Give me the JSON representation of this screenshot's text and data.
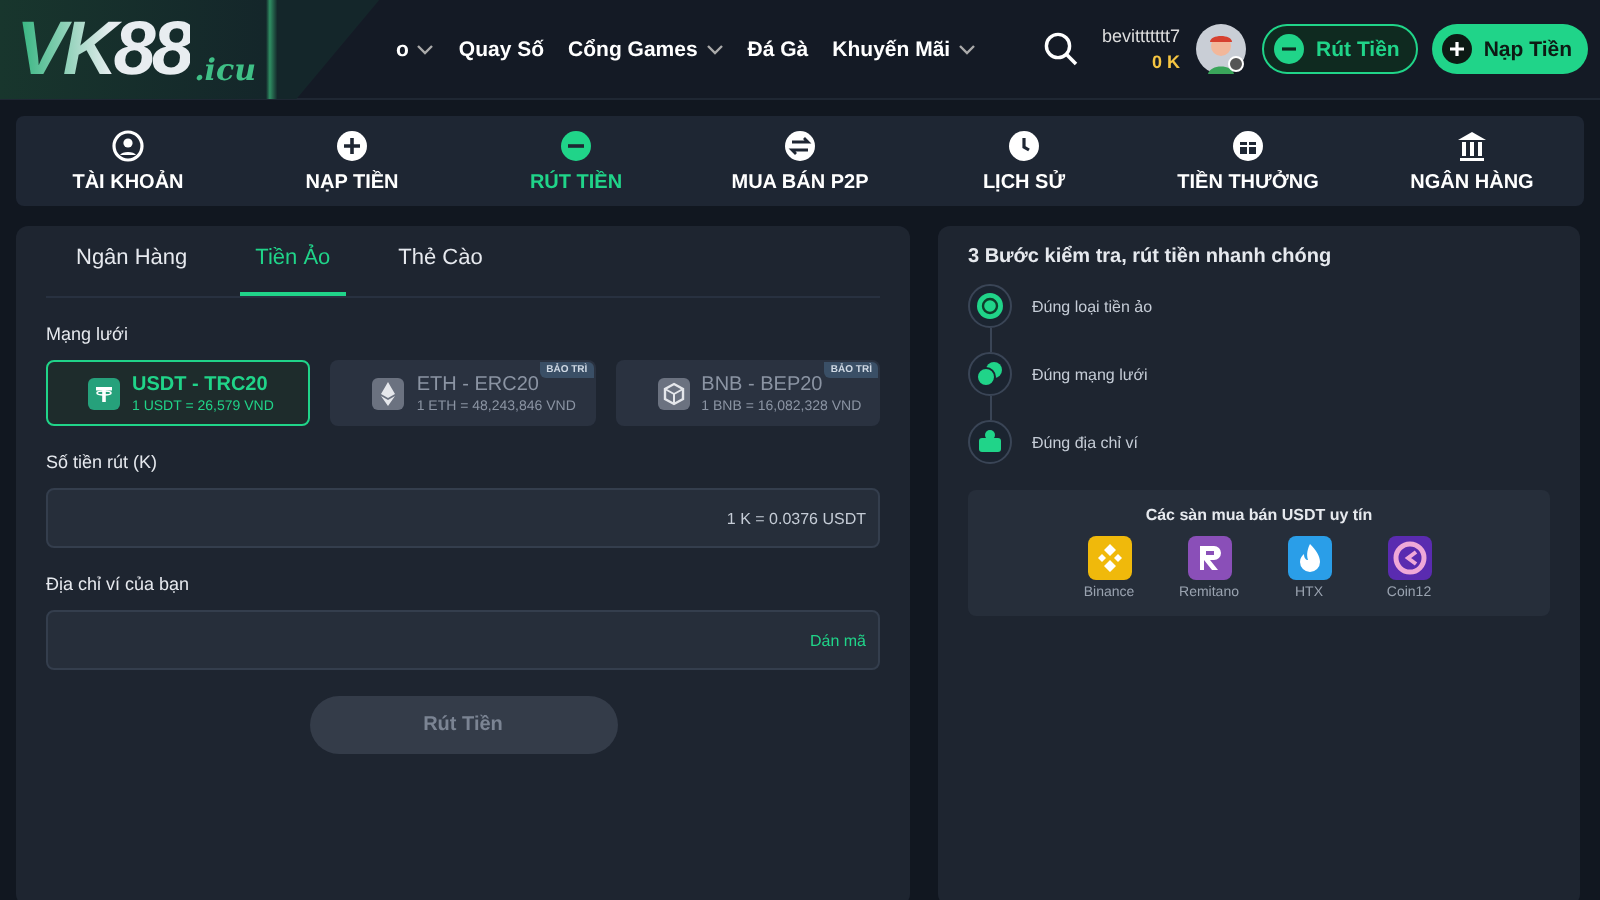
{
  "header": {
    "logo": {
      "name": "VK88",
      "domain": ".icu"
    },
    "nav": [
      {
        "label": "o",
        "dropdown": true
      },
      {
        "label": "Quay Số",
        "dropdown": false
      },
      {
        "label": "Cổng Games",
        "dropdown": true
      },
      {
        "label": "Đá Gà",
        "dropdown": false
      },
      {
        "label": "Khuyến Mãi",
        "dropdown": true
      }
    ],
    "user": {
      "name": "bevittttttt7",
      "balance": "0 K"
    },
    "buttons": [
      {
        "label": "Rút Tiền",
        "kind": "outline"
      },
      {
        "label": "Nạp Tiền",
        "kind": "filled"
      }
    ]
  },
  "menu": [
    {
      "label": "TÀI KHOẢN",
      "selected": false
    },
    {
      "label": "NẠP TIỀN",
      "selected": false
    },
    {
      "label": "RÚT TIỀN",
      "selected": true
    },
    {
      "label": "MUA BÁN P2P",
      "selected": false
    },
    {
      "label": "LỊCH SỬ",
      "selected": false
    },
    {
      "label": "TIỀN THƯỞNG",
      "selected": false
    },
    {
      "label": "NGÂN HÀNG",
      "selected": false
    }
  ],
  "tabs": [
    {
      "label": "Ngân Hàng",
      "selected": false
    },
    {
      "label": "Tiền Ảo",
      "selected": true
    },
    {
      "label": "Thẻ Cào",
      "selected": false
    }
  ],
  "network": {
    "label": "Mạng lưới",
    "options": [
      {
        "name": "USDT - TRC20",
        "rate": "1 USDT = 26,579 VND",
        "selected": true,
        "disabled": false
      },
      {
        "name": "ETH - ERC20",
        "rate": "1 ETH = 48,243,846 VND",
        "selected": false,
        "disabled": true,
        "badge": "BẢO TRÌ"
      },
      {
        "name": "BNB - BEP20",
        "rate": "1 BNB = 16,082,328 VND",
        "selected": false,
        "disabled": true,
        "badge": "BẢO TRÌ"
      }
    ]
  },
  "amount": {
    "label": "Số tiền rút (K)",
    "hint": "1 K = 0.0376 USDT"
  },
  "address": {
    "label": "Địa chỉ ví của bạn",
    "action": "Dán mã"
  },
  "submit": {
    "label": "Rút Tiền",
    "disabled": true
  },
  "guide": {
    "title": "3 Bước kiểm tra, rút tiền nhanh chóng",
    "steps": [
      "Đúng loại tiền ảo",
      "Đúng mạng lưới",
      "Đúng địa chỉ ví"
    ],
    "exchanges_title": "Các sàn mua bán USDT uy tín",
    "exchanges": [
      {
        "name": "Binance",
        "color": "#f0b90b"
      },
      {
        "name": "Remitano",
        "color": "#8a4fb8"
      },
      {
        "name": "HTX",
        "color": "#2a9ee8"
      },
      {
        "name": "Coin12",
        "color": "#5a2bb0"
      }
    ]
  }
}
